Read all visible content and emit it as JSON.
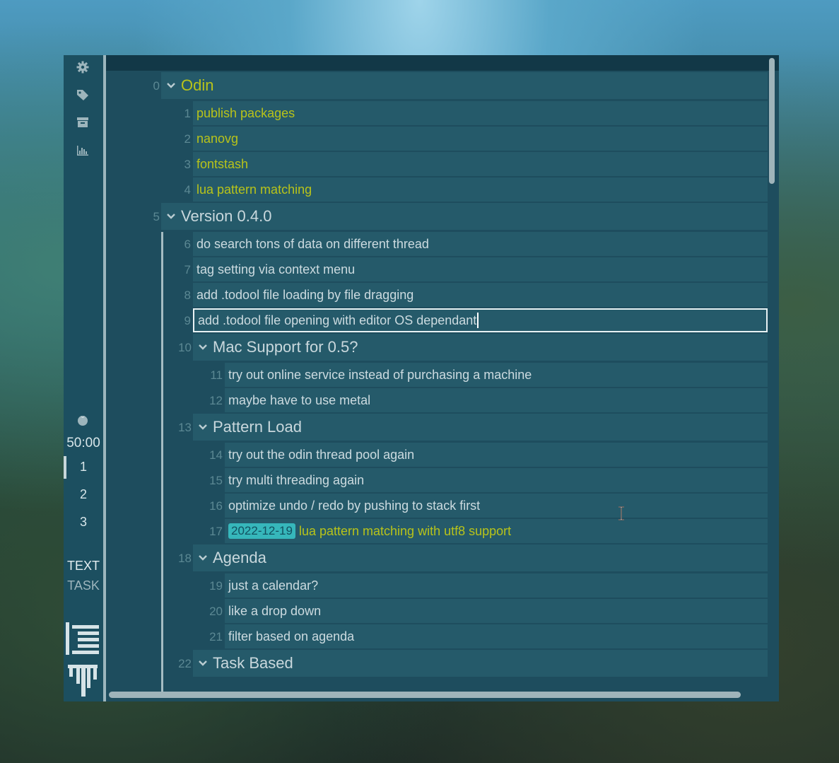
{
  "sidebar": {
    "icons": [
      "gear-icon",
      "tag-icon",
      "archive-icon",
      "chart-icon"
    ],
    "pomodoro_icon": "tomato-icon",
    "timer": "50:00",
    "pomodoro_slots": [
      "1",
      "2",
      "3"
    ],
    "modes": {
      "text": "TEXT",
      "task": "TASK"
    },
    "bottom_icons": [
      "align-right-icon",
      "comb-icon"
    ]
  },
  "colors": {
    "accent_yellow": "#b8c31a",
    "date_chip": "#36b7bb",
    "bar": "#255a6a",
    "sidebar": "#1c4f60"
  },
  "tasks": [
    {
      "index": "0",
      "text": "Odin",
      "heading": true,
      "level": 0,
      "color": "yellow"
    },
    {
      "index": "1",
      "text": "publish packages",
      "level": 1,
      "color": "yellow"
    },
    {
      "index": "2",
      "text": "nanovg",
      "level": 1,
      "color": "yellow"
    },
    {
      "index": "3",
      "text": "fontstash",
      "level": 1,
      "color": "yellow"
    },
    {
      "index": "4",
      "text": "lua pattern matching",
      "level": 1,
      "color": "yellow"
    },
    {
      "index": "5",
      "text": "Version 0.4.0",
      "heading": true,
      "level": 0
    },
    {
      "index": "6",
      "text": "do search tons of data on different thread",
      "level": 1
    },
    {
      "index": "7",
      "text": "tag setting via context menu",
      "level": 1
    },
    {
      "index": "8",
      "text": "add .todool file loading by file dragging",
      "level": 1
    },
    {
      "index": "9",
      "text": "add .todool file opening with editor OS dependant",
      "level": 1,
      "editing": true
    },
    {
      "index": "10",
      "text": "Mac Support for 0.5?",
      "heading": true,
      "level": 1
    },
    {
      "index": "11",
      "text": "try out online service instead of purchasing a machine",
      "level": 2
    },
    {
      "index": "12",
      "text": "maybe have to use metal",
      "level": 2
    },
    {
      "index": "13",
      "text": "Pattern Load",
      "heading": true,
      "level": 1
    },
    {
      "index": "14",
      "text": "try out the odin thread pool again",
      "level": 2
    },
    {
      "index": "15",
      "text": "try multi threading again",
      "level": 2
    },
    {
      "index": "16",
      "text": "optimize undo / redo by pushing to stack first",
      "level": 2
    },
    {
      "index": "17",
      "text": "lua pattern matching with utf8 support",
      "level": 2,
      "color": "yellow",
      "date": "2022-12-19"
    },
    {
      "index": "18",
      "text": "Agenda",
      "heading": true,
      "level": 1
    },
    {
      "index": "19",
      "text": "just a calendar?",
      "level": 2
    },
    {
      "index": "20",
      "text": "like a drop down",
      "level": 2
    },
    {
      "index": "21",
      "text": "filter based on agenda",
      "level": 2
    },
    {
      "index": "22",
      "text": "Task Based",
      "heading": true,
      "level": 1
    }
  ]
}
